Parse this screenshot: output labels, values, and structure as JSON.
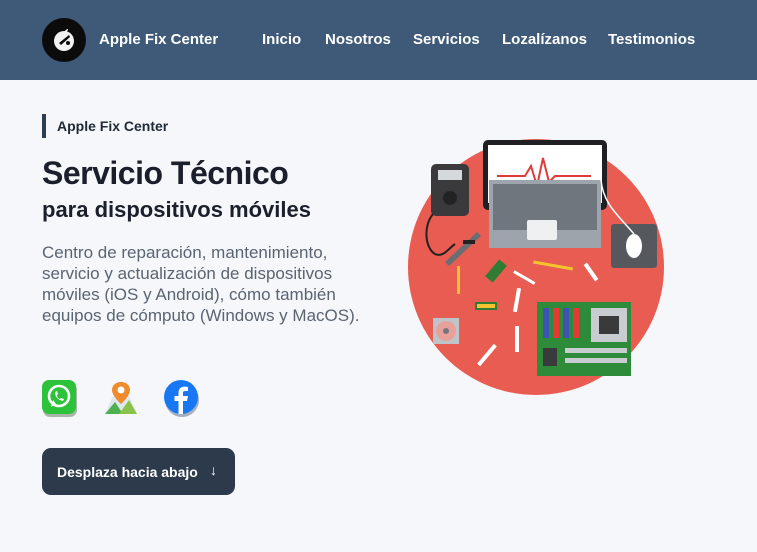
{
  "header": {
    "brand": "Apple Fix Center",
    "menu": [
      "Inicio",
      "Nosotros",
      "Servicios",
      "Lozalízanos",
      "Testimonios"
    ]
  },
  "hero": {
    "eyebrow": "Apple Fix Center",
    "title": "Servicio Técnico",
    "subtitle": "para dispositivos móviles",
    "description": "Centro de reparación, mantenimiento, servicio y actualización de dispositivos móviles (iOS y Android), cómo también equipos de cómputo (Windows y MacOS).",
    "cta_label": "Desplaza hacia abajo",
    "cta_icon": "arrow-down-icon"
  },
  "social_icons": [
    "whatsapp-icon",
    "maps-icon",
    "facebook-icon"
  ],
  "colors": {
    "nav": "#3f5a78",
    "accent_circle": "#e85c52",
    "button": "#2c3a4b"
  }
}
